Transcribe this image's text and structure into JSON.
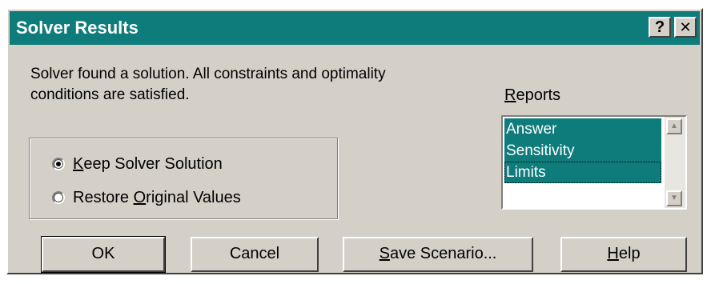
{
  "window": {
    "title": "Solver Results",
    "help_glyph": "?",
    "close_glyph": "✕"
  },
  "message": {
    "line1": "Solver found a solution.  All constraints and optimality",
    "line2": "conditions are satisfied."
  },
  "reports": {
    "label_accel": "R",
    "label_rest": "eports",
    "items": [
      "Answer",
      "Sensitivity",
      "Limits"
    ]
  },
  "options": {
    "keep": {
      "pre": "",
      "accel": "K",
      "post": "eep Solver Solution",
      "checked": true
    },
    "restore": {
      "pre": "Restore ",
      "accel": "O",
      "post": "riginal Values",
      "checked": false
    }
  },
  "buttons": {
    "ok": "OK",
    "cancel": "Cancel",
    "save_accel": "S",
    "save_rest": "ave Scenario...",
    "help_accel": "H",
    "help_rest": "elp"
  },
  "colors": {
    "title_bar": "#0e7c7b",
    "selection": "#0e7c7b",
    "face": "#d4d0c8"
  },
  "icons": {
    "scroll_up": "up-arrow-icon",
    "scroll_down": "down-arrow-icon"
  }
}
